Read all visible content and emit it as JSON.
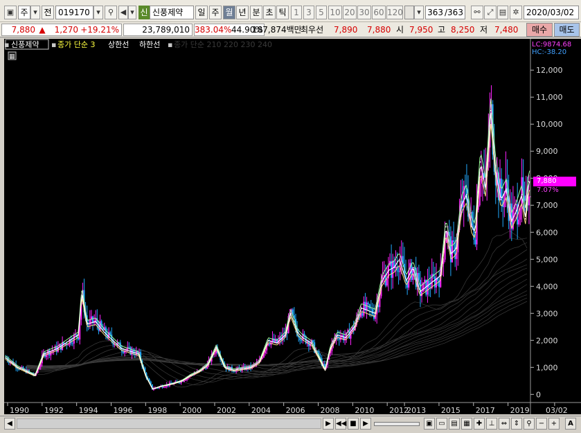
{
  "toolbar": {
    "market": "주",
    "prev_label": "전",
    "code": "019170",
    "stock_badge": "신",
    "stock_name": "신풍제약",
    "periods": [
      "일",
      "주",
      "월",
      "년",
      "분",
      "초",
      "틱"
    ],
    "selected_period": "월",
    "intervals": [
      "1",
      "3",
      "5",
      "10",
      "20",
      "30",
      "60",
      "120"
    ],
    "count": "363",
    "count_total": "/363",
    "date": "2020/03/02"
  },
  "quote": {
    "price": "7,880",
    "arrow": "▲",
    "change": "1,270",
    "change_pct": "+19.21%",
    "volume": "23,789,010",
    "ratio1": "383.04%",
    "ratio2": "44.90%",
    "amount": "187,874백만",
    "best_label": "최우선",
    "best_sell": "7,890",
    "best_buy": "7,880",
    "open_label": "시",
    "open": "7,950",
    "high_label": "고",
    "high": "8,250",
    "low_label": "저",
    "low": "7,480",
    "buy_button": "매수",
    "sell_button": "매도"
  },
  "colors": {
    "price_up": "#d60000",
    "buy_bg": "#e9a8a8",
    "sell_bg": "#a8c4ea",
    "candle_up": "#ff22ff",
    "candle_down": "#22aaff",
    "ma3": "#ffffff",
    "upper_line": "#a0ffa0",
    "lower_line": "#ffe080",
    "label_magenta": "#ff40ff",
    "label_cyan": "#40a0ff"
  },
  "chart_data": {
    "type": "line",
    "title": "신풍제약",
    "legend": [
      "종가 단순 3",
      "상한선",
      "하한선",
      "종가 단순 210 220 230 240"
    ],
    "lc_label": "LC:9874.68",
    "hc_label": "HC:-38.20",
    "current_label": "7,880",
    "current_pct": "7.07%",
    "yticks": [
      "12,000",
      "11,000",
      "10,000",
      "9,000",
      "8,000",
      "7,000",
      "6,000",
      "5,000",
      "4,000",
      "3,000",
      "2,000",
      "1,000",
      "0"
    ],
    "ytick_values": [
      12000,
      11000,
      10000,
      9000,
      8000,
      7000,
      6000,
      5000,
      4000,
      3000,
      2000,
      1000,
      0
    ],
    "ylim": [
      -300,
      12800
    ],
    "xlim": [
      1989.7,
      2020.2
    ],
    "xticks": [
      "1990",
      "1992",
      "1994",
      "1996",
      "1998",
      "2000",
      "2002",
      "2004",
      "2006",
      "2008",
      "2010",
      "2012",
      "2013",
      "2015",
      "2017",
      "2019",
      "03/02"
    ],
    "xtick_positions": [
      1989.9,
      1991.9,
      1993.9,
      1995.9,
      1997.9,
      1999.9,
      2001.9,
      2003.9,
      2005.9,
      2007.9,
      2009.9,
      2011.9,
      2012.9,
      2014.9,
      2016.9,
      2018.9,
      2021.6
    ],
    "x": [
      1989.8,
      1990.5,
      1991.0,
      1991.5,
      1992.0,
      1992.8,
      1993.5,
      1994.0,
      1994.2,
      1994.5,
      1995.0,
      1995.5,
      1996.0,
      1996.5,
      1997.0,
      1997.5,
      1997.9,
      1998.3,
      1998.8,
      1999.5,
      2000.0,
      2000.5,
      2001.0,
      2001.5,
      2002.0,
      2002.5,
      2003.0,
      2003.5,
      2004.0,
      2004.5,
      2005.0,
      2005.5,
      2006.0,
      2006.3,
      2006.7,
      2007.0,
      2007.5,
      2008.0,
      2008.3,
      2008.6,
      2009.0,
      2009.5,
      2010.0,
      2010.4,
      2010.8,
      2011.2,
      2011.6,
      2012.0,
      2012.3,
      2012.6,
      2013.0,
      2013.4,
      2013.8,
      2014.2,
      2014.6,
      2015.0,
      2015.3,
      2015.6,
      2015.9,
      2016.2,
      2016.5,
      2016.8,
      2017.0,
      2017.3,
      2017.6,
      2017.9,
      2018.2,
      2018.5,
      2018.8,
      2019.1,
      2019.4,
      2019.7,
      2019.9,
      2020.1
    ],
    "series": [
      {
        "name": "종가 단순 3",
        "values": [
          1350,
          1000,
          850,
          700,
          1500,
          1700,
          2000,
          2200,
          3800,
          2600,
          2700,
          2300,
          2000,
          1700,
          1600,
          1500,
          700,
          200,
          300,
          400,
          500,
          700,
          850,
          1100,
          1750,
          1000,
          900,
          950,
          1000,
          1200,
          2000,
          1900,
          2200,
          3000,
          2300,
          2100,
          1900,
          1300,
          900,
          1700,
          2200,
          2100,
          2500,
          3200,
          3100,
          3000,
          4200,
          4600,
          4700,
          5000,
          4200,
          4700,
          3800,
          4000,
          4200,
          4400,
          6200,
          5200,
          5400,
          7000,
          7400,
          6200,
          6000,
          8600,
          7600,
          10500,
          8200,
          7200,
          7600,
          6400,
          6800,
          7400,
          6500,
          7880
        ]
      }
    ]
  },
  "scrollbar": {
    "zoom_out": "−",
    "zoom_in": "+",
    "a_button": "A"
  }
}
